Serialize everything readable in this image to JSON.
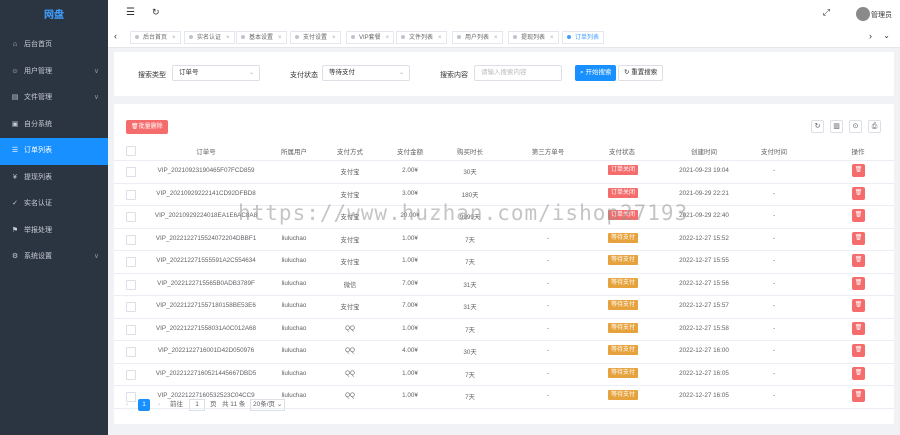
{
  "app": {
    "title": "网盘"
  },
  "sidebar": {
    "items": [
      {
        "label": "后台首页",
        "icon": "home-icon",
        "arrow": ""
      },
      {
        "label": "用户管理",
        "icon": "user-icon",
        "arrow": "∨"
      },
      {
        "label": "文件管理",
        "icon": "file-icon",
        "arrow": "∨"
      },
      {
        "label": "自分系统",
        "icon": "system-icon",
        "arrow": ""
      },
      {
        "label": "订单列表",
        "icon": "order-icon",
        "arrow": ""
      },
      {
        "label": "提现列表",
        "icon": "withdraw-icon",
        "arrow": ""
      },
      {
        "label": "实名认证",
        "icon": "verify-icon",
        "arrow": ""
      },
      {
        "label": "举报处理",
        "icon": "report-icon",
        "arrow": ""
      },
      {
        "label": "系统设置",
        "icon": "settings-icon",
        "arrow": "∨"
      }
    ]
  },
  "header": {
    "username": "管理员"
  },
  "tabs": [
    {
      "label": "后台首页"
    },
    {
      "label": "实名认证"
    },
    {
      "label": "基本设置"
    },
    {
      "label": "支付设置"
    },
    {
      "label": "VIP套餐"
    },
    {
      "label": "文件列表"
    },
    {
      "label": "用户列表"
    },
    {
      "label": "提现列表"
    },
    {
      "label": "订单列表"
    }
  ],
  "search": {
    "type_label": "搜索类型",
    "type_value": "订单号",
    "status_label": "支付状态",
    "status_value": "等待支付",
    "content_label": "搜索内容",
    "content_placeholder": "请输入搜索内容",
    "search_button": "开始搜索",
    "reset_button": "重置搜索"
  },
  "table": {
    "delete_button": "批量删除",
    "headers": [
      "订单号",
      "所属用户",
      "支付方式",
      "支付金额",
      "购买时长",
      "第三方单号",
      "支付状态",
      "创建时间",
      "支付时间",
      "操作"
    ],
    "rows": [
      {
        "order": "VIP_20210923190465F07FCD859",
        "user": "",
        "method": "支付宝",
        "amount": "2.00¥",
        "duration": "30天",
        "third": "",
        "status": "订单关闭",
        "status_color": "#f56c6c",
        "created": "2021-09-23 19:04",
        "paid": "-"
      },
      {
        "order": "VIP_20210929222141CD92DFBD8",
        "user": "",
        "method": "支付宝",
        "amount": "3.00¥",
        "duration": "180天",
        "third": "",
        "status": "订单关闭",
        "status_color": "#f56c6c",
        "created": "2021-09-29 22:21",
        "paid": "-"
      },
      {
        "order": "VIP_20210929224018EA1E6AC8A8",
        "user": "",
        "method": "支付宝",
        "amount": "20.00¥",
        "duration": "9999天",
        "third": "",
        "status": "订单关闭",
        "status_color": "#f56c6c",
        "created": "2021-09-29 22:40",
        "paid": "-"
      },
      {
        "order": "VIP_2022122715524072204DBBF1",
        "user": "liuluchao",
        "method": "支付宝",
        "amount": "1.00¥",
        "duration": "7天",
        "third": "-",
        "status": "等待支付",
        "status_color": "#e6a23c",
        "created": "2022-12-27 15:52",
        "paid": "-"
      },
      {
        "order": "VIP_202212271555591A2C554634",
        "user": "liuluchao",
        "method": "支付宝",
        "amount": "1.00¥",
        "duration": "7天",
        "third": "-",
        "status": "等待支付",
        "status_color": "#e6a23c",
        "created": "2022-12-27 15:55",
        "paid": "-"
      },
      {
        "order": "VIP_2022122715565B0ADB3789F",
        "user": "liuluchao",
        "method": "微信",
        "amount": "7.00¥",
        "duration": "31天",
        "third": "-",
        "status": "等待支付",
        "status_color": "#e6a23c",
        "created": "2022-12-27 15:56",
        "paid": "-"
      },
      {
        "order": "VIP_202212271557180158BE53E6",
        "user": "liuluchao",
        "method": "支付宝",
        "amount": "7.00¥",
        "duration": "31天",
        "third": "-",
        "status": "等待支付",
        "status_color": "#e6a23c",
        "created": "2022-12-27 15:57",
        "paid": "-"
      },
      {
        "order": "VIP_202212271558031A0C012A68",
        "user": "liuluchao",
        "method": "QQ",
        "amount": "1.00¥",
        "duration": "7天",
        "third": "-",
        "status": "等待支付",
        "status_color": "#e6a23c",
        "created": "2022-12-27 15:58",
        "paid": "-"
      },
      {
        "order": "VIP_2022122716001D42D050976",
        "user": "liuluchao",
        "method": "QQ",
        "amount": "4.00¥",
        "duration": "30天",
        "third": "-",
        "status": "等待支付",
        "status_color": "#e6a23c",
        "created": "2022-12-27 16:00",
        "paid": "-"
      },
      {
        "order": "VIP_20221227160521445667DBD5",
        "user": "liuluchao",
        "method": "QQ",
        "amount": "1.00¥",
        "duration": "7天",
        "third": "-",
        "status": "等待支付",
        "status_color": "#e6a23c",
        "created": "2022-12-27 16:05",
        "paid": "-"
      },
      {
        "order": "VIP_20221227160532523C04CC9",
        "user": "liuluchao",
        "method": "QQ",
        "amount": "1.00¥",
        "duration": "7天",
        "third": "-",
        "status": "等待支付",
        "status_color": "#e6a23c",
        "created": "2022-12-27 16:05",
        "paid": "-"
      }
    ]
  },
  "pager": {
    "current": "1",
    "goto_label": "前往",
    "goto_value": "1",
    "page_unit": "页",
    "total": "共 11 条",
    "page_size": "20条/页"
  },
  "watermark": "https://www.huzhan.com/ishop27193"
}
